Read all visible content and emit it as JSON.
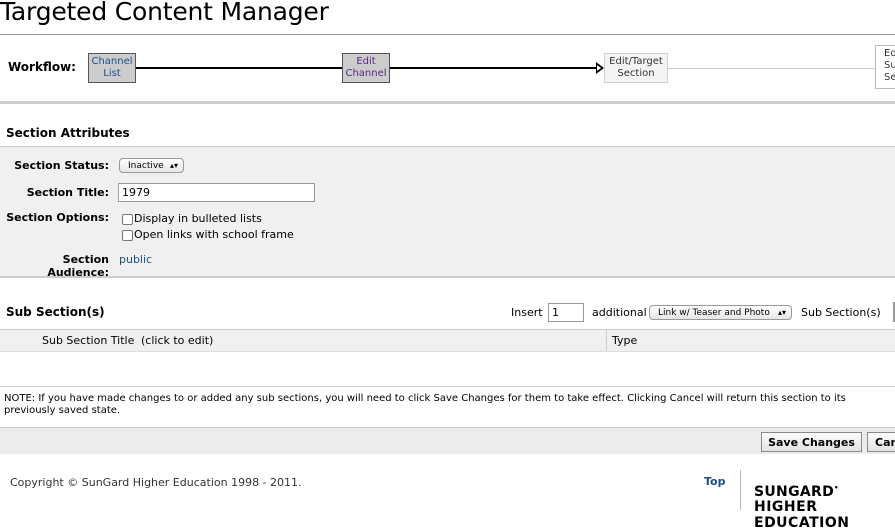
{
  "page": {
    "title": "Targeted Content Manager"
  },
  "workflow": {
    "label": "Workflow:",
    "steps": [
      {
        "label": "Channel List"
      },
      {
        "label": "Edit Channel"
      },
      {
        "label": "Edit/Target Section"
      },
      {
        "label": "Edit Sub Section"
      }
    ]
  },
  "section_attributes": {
    "heading": "Section Attributes",
    "status_label": "Section Status:",
    "status_value": "Inactive",
    "title_label": "Section Title:",
    "title_value": "1979",
    "options_label": "Section Options:",
    "options": [
      {
        "label": "Display in bulleted lists",
        "checked": false
      },
      {
        "label": "Open links with school frame",
        "checked": false
      }
    ],
    "audience_label": "Section Audience:",
    "audience_value": "public"
  },
  "sub_sections": {
    "heading": "Sub Section(s)",
    "insert_label": "Insert",
    "insert_value": "1",
    "additional_label": "additional",
    "type_select": "Link w/ Teaser and Photo",
    "suffix_label": "Sub Section(s)",
    "columns": [
      "Sub Section Title",
      "(click to edit)",
      "Type"
    ]
  },
  "note": "NOTE: If you have made changes to or added any sub sections, you will need to click Save Changes for them to take effect. Clicking Cancel will return this section to its previously saved state.",
  "buttons": {
    "save": "Save Changes",
    "cancel": "Cancel"
  },
  "footer": {
    "copyright": "Copyright © SunGard Higher Education 1998 - 2011.",
    "top_link": "Top",
    "logo_line1": "SUNGARD",
    "logo_line2": "HIGHER EDUCATION"
  },
  "colors": {
    "link": "#1a4f8a",
    "panel_bg": "#f0f0f0"
  }
}
